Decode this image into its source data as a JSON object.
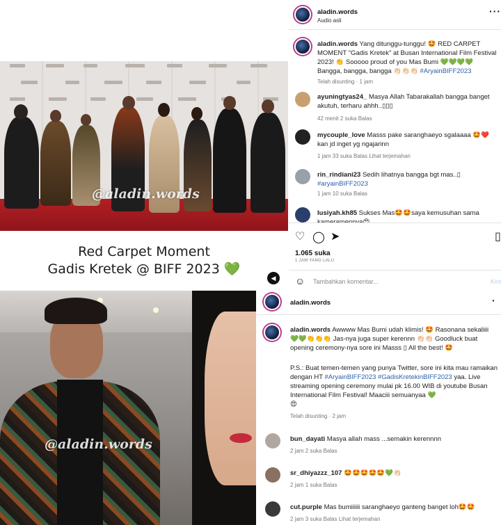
{
  "top_post": {
    "username": "aladin.words",
    "subtitle": "Audio asli",
    "caption_user": "aladin.words",
    "caption_text": "Yang ditunggu-tunggu! 🤩 RED CARPET MOMENT \"Gadis Kretek\" at Busan International Film Festival 2023! 👏 Sooooo proud of you Mas Bumi",
    "caption_hearts": "💚💚💚💚",
    "caption_tail": "Bangga, bangga, bangga 👏🏻👏🏻👏🏻",
    "caption_tag": "#AryainBIFF2023",
    "caption_time": "Telah disunting · 1 jam",
    "comments": [
      {
        "user": "ayuningtyas24_",
        "text": "Masya Allah Tabarakallah bangga banget akutuh, terharu ahhh..▯▯▯",
        "meta": "42 menit   2 suka   Balas",
        "color": "#c8a070"
      },
      {
        "user": "mycouple_love",
        "text": "Masss pake saranghaeyo sgalaaaa 🤩❤️ kan jd inget yg ngajarinn",
        "meta": "1 jam   33 suka   Balas   Lihat terjemahan",
        "color": "#222222"
      },
      {
        "user": "rin_rindiani23",
        "text": "Sedih lihatnya bangga bgt mas..▯",
        "tag": "#aryainBIFF2023",
        "meta": "1 jam   10 suka   Balas",
        "color": "#9aa0a8"
      },
      {
        "user": "lusiyah.kh85",
        "text": "Sukses Mas🤩🤩saya kemusuhan sama kameramennya😍",
        "meta": "",
        "color": "#2a3f6a"
      }
    ],
    "likes": "1.065 suka",
    "time_ago": "1 JAM YANG LALU",
    "comment_placeholder": "Tambahkan komentar...",
    "post_label": "Kirim"
  },
  "photo1": {
    "watermark": "@aladin.words"
  },
  "caption_overlay": {
    "line1": "Red Carpet Moment",
    "line2": "Gadis Kretek @ BIFF 2023",
    "heart": "💚"
  },
  "photo2": {
    "watermark": "@aladin.words"
  },
  "bottom_post": {
    "username": "aladin.words",
    "caption_user": "aladin.words",
    "caption_text": "Awwww Mas Bumi udah klimis! 🤩 Rasonana sekaliiii",
    "caption_l2": "💚💚👏👏👏 Jas-nya juga super kerennn 👏🏻👏🏻 Goodluck buat opening ceremony-nya sore ini Masss ▯ All the best! 🤩",
    "caption_ps": "P.S.: Buat temen-temen yang punya Twitter, sore ini kita mau ramaikan dengan HT",
    "caption_tags": "#AryainBIFF2023 #GadisKretekinBIFF2023",
    "caption_ps2": "yaa. Live streaming opening ceremony mulai pk 16.00 WIB di youtube Busan International Film Festival! Maaciii semuanyaa 💚",
    "caption_emoji": "😍",
    "caption_time": "Telah disunting · 2 jam",
    "comments": [
      {
        "user": "bun_dayati",
        "text": "Masya allah mass ...semakin kerennnn",
        "meta": "2 jam   2 suka   Balas",
        "color": "#b0a8a0"
      },
      {
        "user": "sr_dhiyazzz_107",
        "text": "🤩🤩🤩🤩🤩💚👏🏻",
        "meta": "2 jam   1 suka   Balas",
        "color": "#8a7060"
      },
      {
        "user": "cut.purple",
        "text": "Mas bumiiiiii saranghaeyo ganteng banget loh🤩🤩",
        "meta": "2 jam   3 suka   Balas   Lihat terjemahan",
        "color": "#3a3a3a"
      }
    ]
  },
  "colors": {
    "accent": "#2b5fa8",
    "carpet": "#a81c22",
    "green_heart": "#3dbb3d"
  }
}
